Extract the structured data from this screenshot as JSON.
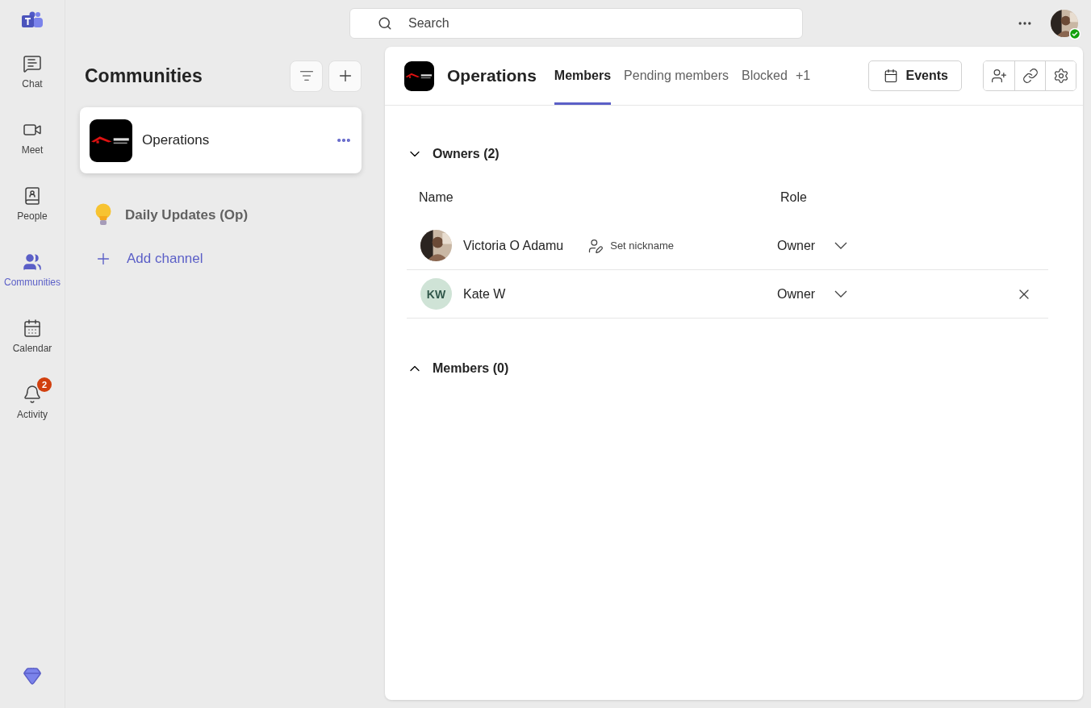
{
  "rail": {
    "items": [
      {
        "label": "Chat",
        "selected": false
      },
      {
        "label": "Meet",
        "selected": false
      },
      {
        "label": "People",
        "selected": false
      },
      {
        "label": "Communities",
        "selected": true
      },
      {
        "label": "Calendar",
        "selected": false
      },
      {
        "label": "Activity",
        "selected": false,
        "badge": "2"
      }
    ]
  },
  "search": {
    "placeholder": "Search"
  },
  "sidebar": {
    "title": "Communities",
    "communities": [
      {
        "name": "Operations",
        "selected": true
      }
    ],
    "channels": [
      {
        "name": "Daily Updates (Op)"
      }
    ],
    "add_channel": "Add channel"
  },
  "main": {
    "title": "Operations",
    "tabs": [
      {
        "label": "Members",
        "selected": true
      },
      {
        "label": "Pending members",
        "selected": false
      },
      {
        "label": "Blocked",
        "selected": false
      }
    ],
    "more_tabs": "+1",
    "events_button": "Events",
    "sections": [
      {
        "title": "Owners (2)",
        "expanded": true,
        "columns": [
          "Name",
          "Role"
        ],
        "members": [
          {
            "name": "Victoria O Adamu",
            "nickname_action": "Set nickname",
            "role": "Owner",
            "removable": false
          },
          {
            "name": "Kate W",
            "avatar": {
              "kind": "initials",
              "initials": "KW"
            },
            "role": "Owner",
            "removable": true
          }
        ]
      },
      {
        "title": "Members (0)",
        "expanded": false
      }
    ]
  }
}
